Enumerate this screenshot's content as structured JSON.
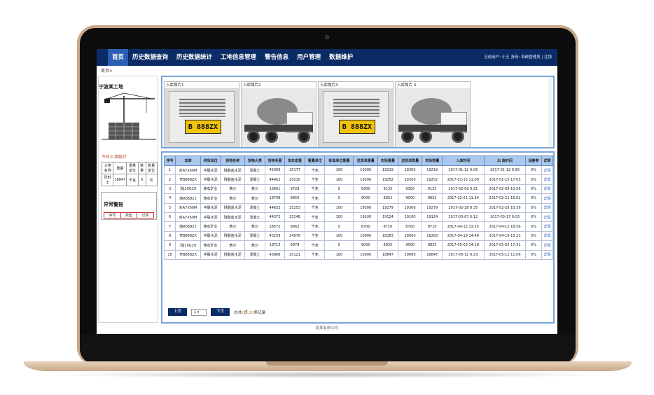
{
  "nav": {
    "tabs": [
      "首页",
      "历史数据查询",
      "历史数据统计",
      "工地信息管理",
      "警告信息",
      "用户管理",
      "数据维护"
    ],
    "active_index": 0,
    "user_info": "当前用户: 小王 身份: 系统管理员 | 注销"
  },
  "breadcrumb": "首页>",
  "left": {
    "site_title": "宁波某工地",
    "today_title": "今日入场统计",
    "stat_headers": [
      "大类名称",
      "重量",
      "重量单位",
      "数量",
      "数量单位"
    ],
    "stat_row": [
      "砼料土",
      "18847",
      "千克",
      "0",
      "件"
    ],
    "alarm_title": "异常警报",
    "alarm_headers": [
      "序号",
      "类型",
      "详情"
    ]
  },
  "photos": [
    {
      "caption": "入库照片1",
      "plate": "B 888ZX",
      "kind": "front"
    },
    {
      "caption": "入库照片2",
      "kind": "side"
    },
    {
      "caption": "入库照片3",
      "plate": "B 888ZX",
      "kind": "front"
    },
    {
      "caption": "入库照片 4",
      "kind": "side"
    }
  ],
  "table": {
    "headers": [
      "序号",
      "车牌",
      "供货单位",
      "货物名称",
      "货物大类",
      "货物毛重",
      "货车皮重",
      "重量单位",
      "标准单位重量",
      "送货单重量",
      "实际重量",
      "送货单数量",
      "实际数量",
      "入库时间",
      "出 库时间",
      "误差率",
      "详情"
    ],
    "rows": [
      [
        "1",
        "京A7X60M",
        "中联水泥",
        "硅酸盐水泥",
        "混凝土",
        "45009",
        "25177",
        "千克",
        "100",
        "19300",
        "19219",
        "19300",
        "19219",
        "2017-01-12 9:05",
        "2017-01-12 9:56",
        "0%",
        "详情"
      ],
      [
        "2",
        "粤B888ZX",
        "中联水泥",
        "硅酸盐水泥",
        "混凝土",
        "44462",
        "25210",
        "千克",
        "100",
        "19200",
        "19252",
        "19200",
        "19252",
        "2017-01-15 11:00",
        "2017-01-15 17:03",
        "0%",
        "详情"
      ],
      [
        "3",
        "浙J20G29",
        "黄石矿业",
        "黄沙",
        "黄沙",
        "18661",
        "9728",
        "千克",
        "0",
        "9300",
        "9133",
        "9300",
        "9133",
        "2017-02-09 9:21",
        "2017-02-09 10:56",
        "0%",
        "详情"
      ],
      [
        "4",
        "皖A36821",
        "黄石矿业",
        "黄沙",
        "黄沙",
        "18708",
        "9856",
        "千克",
        "0",
        "9000",
        "8852",
        "9000",
        "8852",
        "2017-02-21 11:34",
        "2017-02-21 16:52",
        "0%",
        "详情"
      ],
      [
        "5",
        "京A7X60M",
        "中联水泥",
        "硅酸盐水泥",
        "混凝土",
        "44632",
        "25253",
        "千克",
        "100",
        "19300",
        "19279",
        "19300",
        "19279",
        "2017-02-28 8:35",
        "2017-02-28 10:39",
        "0%",
        "详情"
      ],
      [
        "6",
        "京A7X60M",
        "中联水泥",
        "硅酸盐水泥",
        "混凝土",
        "44372",
        "25248",
        "千克",
        "100",
        "19100",
        "19124",
        "19100",
        "19124",
        "2017-03-07 6:12",
        "2017-03-17 9:03",
        "0%",
        "详情"
      ],
      [
        "7",
        "皖A36821",
        "黄石矿业",
        "黄沙",
        "黄沙",
        "18572",
        "9862",
        "千克",
        "0",
        "8700",
        "8710",
        "8700",
        "8710",
        "2017-04-12 13:25",
        "2017-04-12 18:56",
        "0%",
        "详情"
      ],
      [
        "8",
        "粤B888ZX",
        "中联水泥",
        "硅酸盐水泥",
        "混凝土",
        "43259",
        "24976",
        "千克",
        "100",
        "18000",
        "18283",
        "18000",
        "18283",
        "2017-04-19 14:46",
        "2017-04-19 15:23",
        "0%",
        "详情"
      ],
      [
        "9",
        "浙J20G29",
        "黄石矿业",
        "黄沙",
        "黄沙",
        "18713",
        "9878",
        "千克",
        "0",
        "9000",
        "8835",
        "9000",
        "8835",
        "2017-05-03 14:18",
        "2017-05-03 17:31",
        "0%",
        "详情"
      ],
      [
        "10",
        "粤B888ZX",
        "中联水泥",
        "硅酸盐水泥",
        "混凝土",
        "43968",
        "25121",
        "千克",
        "100",
        "19000",
        "18847",
        "19000",
        "18847",
        "2017-05-12 9:23",
        "2017-05-12 11:06",
        "0%",
        "详情"
      ]
    ]
  },
  "pager": {
    "prev_label": "上页",
    "page_value": "1",
    "next_label": "下页",
    "summary_prefix": "总共",
    "total_pages": "1",
    "summary_mid": "页,",
    "total_records": "10",
    "summary_suffix": "条记录"
  },
  "footer": "某某有限公司"
}
